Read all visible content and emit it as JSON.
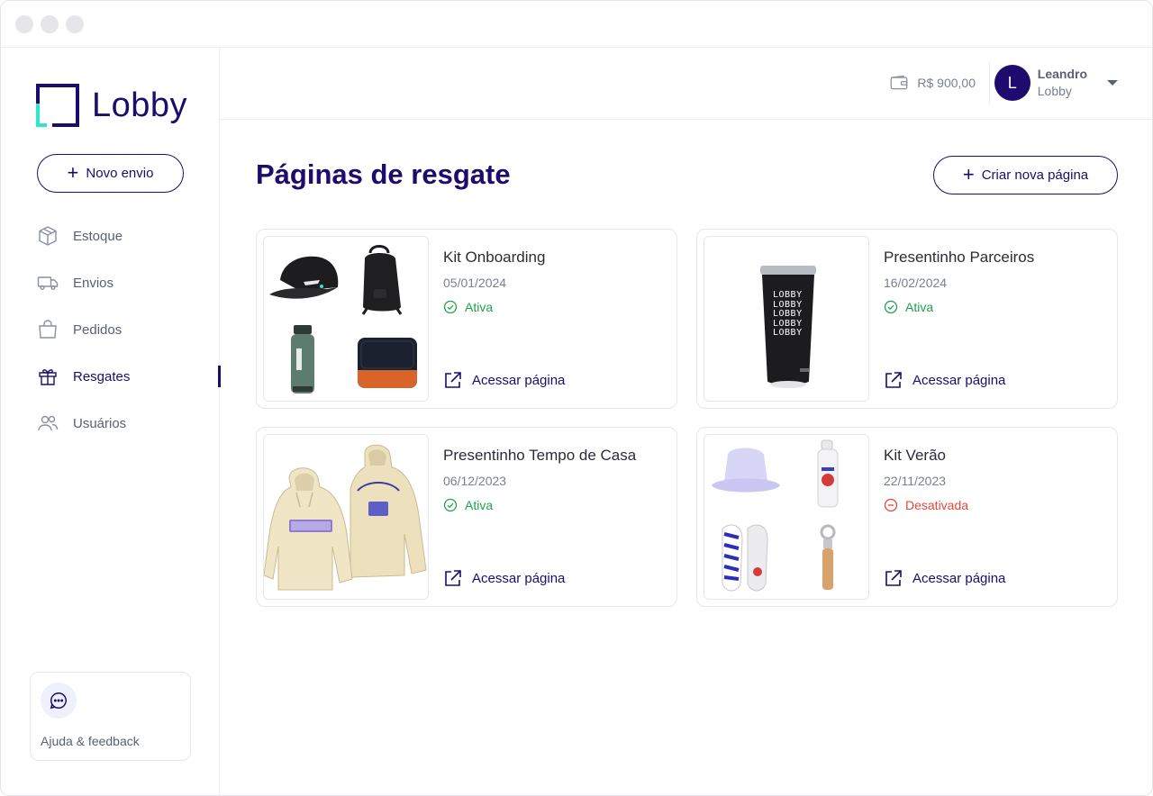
{
  "app": {
    "brand": "Lobby"
  },
  "sidebar": {
    "new_button": "Novo envio",
    "items": [
      {
        "label": "Estoque",
        "icon": "box-icon"
      },
      {
        "label": "Envios",
        "icon": "truck-icon"
      },
      {
        "label": "Pedidos",
        "icon": "bag-icon"
      },
      {
        "label": "Resgates",
        "icon": "gift-icon",
        "active": true
      },
      {
        "label": "Usuários",
        "icon": "users-icon"
      }
    ],
    "help": "Ajuda & feedback"
  },
  "topbar": {
    "balance": "R$ 900,00",
    "user": {
      "initial": "L",
      "name": "Leandro",
      "org": "Lobby"
    }
  },
  "main": {
    "title": "Páginas de resgate",
    "create_button": "Criar nova página",
    "cards": [
      {
        "title": "Kit Onboarding",
        "date": "05/01/2024",
        "status": "Ativa",
        "link": "Acessar página"
      },
      {
        "title": "Presentinho Parceiros",
        "date": "16/02/2024",
        "status": "Ativa",
        "link": "Acessar página"
      },
      {
        "title": "Presentinho Tempo de Casa",
        "date": "06/12/2023",
        "status": "Ativa",
        "link": "Acessar página"
      },
      {
        "title": "Kit Verão",
        "date": "22/11/2023",
        "status": "Desativada",
        "link": "Acessar página"
      }
    ],
    "tumbler_text": "LOBBY"
  },
  "colors": {
    "brand": "#1e0b6e",
    "active": "#22a04b",
    "inactive": "#e0483e",
    "accent": "#2ee6c8"
  }
}
